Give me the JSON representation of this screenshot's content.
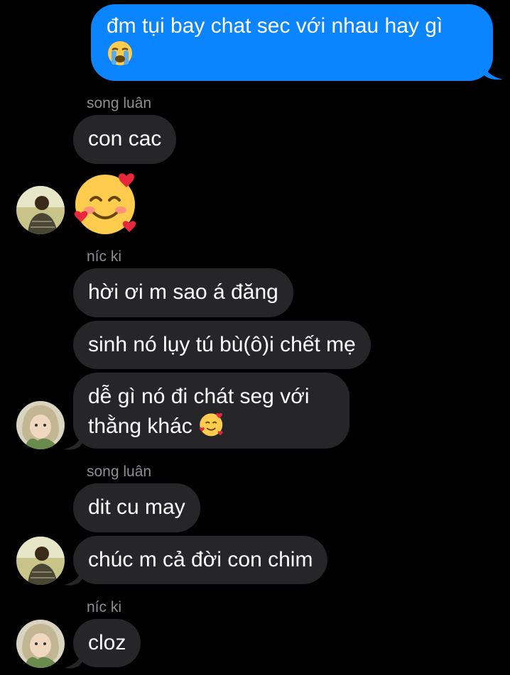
{
  "conversation": {
    "outgoing_message": {
      "text": "đm tụi bay chat sec với nhau hay gì",
      "emoji": "loudly-crying-face-emoji"
    },
    "senders": {
      "first": "song luân",
      "second": "níc ki",
      "third": "song luân",
      "fourth": "níc ki"
    },
    "messages": {
      "m1": "con cac",
      "m2_emoji": "smiling-face-with-hearts-emoji",
      "m3": "hời ơi m sao á đăng",
      "m4": "sinh nó lụy tú bù(ô)i chết mẹ",
      "m5_line1": "dễ gì nó đi chát seg với",
      "m5_line2": "thằng khác",
      "m5_emoji": "smiling-face-with-hearts-emoji",
      "m6": "dit cu may",
      "m7": "chúc m cả đời con chim",
      "m8": "cloz"
    },
    "colors": {
      "background": "#000000",
      "outgoing_bubble": "#0a84ff",
      "incoming_bubble": "#262628",
      "sender_name": "#8e8e93"
    }
  }
}
